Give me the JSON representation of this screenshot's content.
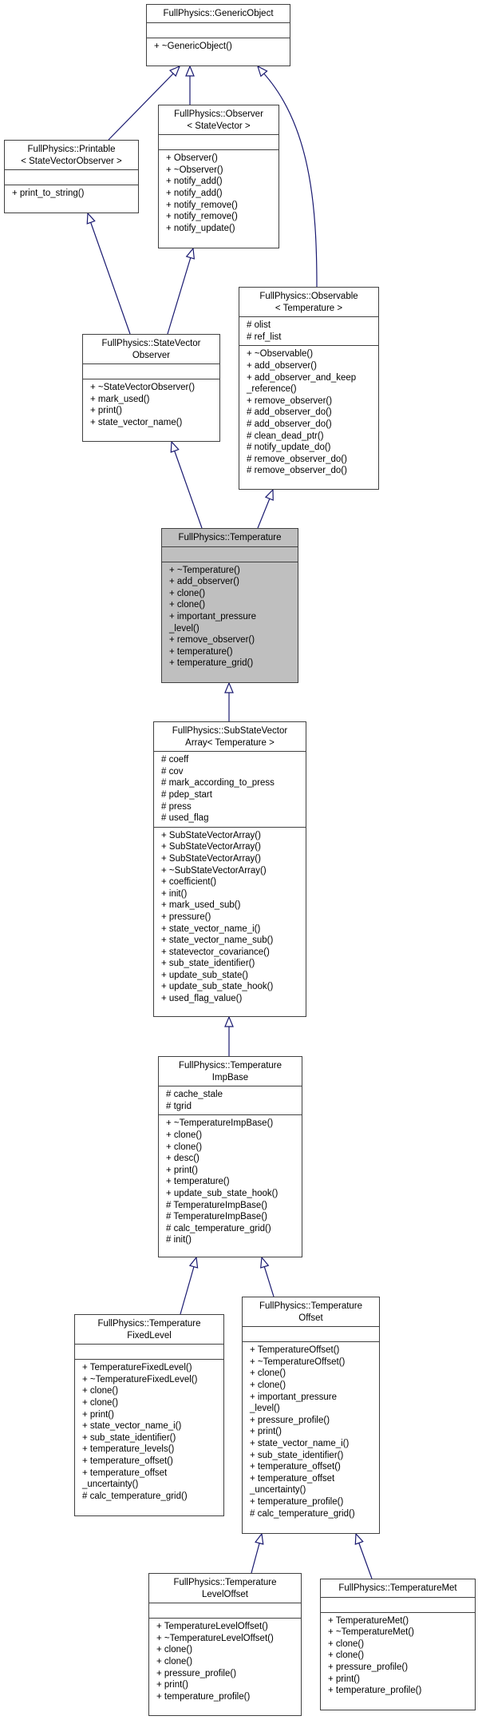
{
  "diagram": {
    "type": "class-inheritance",
    "edge_color": "#191970",
    "focus_fill": "#bfbfbf",
    "classes": {
      "generic_object": {
        "title": "FullPhysics::GenericObject",
        "attributes": [],
        "methods": [
          "+ ~GenericObject()"
        ]
      },
      "printable": {
        "title": "FullPhysics::Printable\n< StateVectorObserver >",
        "attributes": [],
        "methods": [
          "+ print_to_string()"
        ]
      },
      "observer": {
        "title": "FullPhysics::Observer\n< StateVector >",
        "attributes": [],
        "methods": [
          "+ Observer()",
          "+ ~Observer()",
          "+ notify_add()",
          "+ notify_add()",
          "+ notify_remove()",
          "+ notify_remove()",
          "+ notify_update()"
        ]
      },
      "state_vector_observer": {
        "title": "FullPhysics::StateVector\nObserver",
        "attributes": [],
        "methods": [
          "+ ~StateVectorObserver()",
          "+ mark_used()",
          "+ print()",
          "+ state_vector_name()"
        ]
      },
      "observable": {
        "title": "FullPhysics::Observable\n< Temperature >",
        "attributes": [
          "# olist",
          "# ref_list"
        ],
        "methods": [
          "+ ~Observable()",
          "+ add_observer()",
          "+ add_observer_and_keep",
          "_reference()",
          "+ remove_observer()",
          "# add_observer_do()",
          "# add_observer_do()",
          "# clean_dead_ptr()",
          "# notify_update_do()",
          "# remove_observer_do()",
          "# remove_observer_do()"
        ]
      },
      "temperature": {
        "title": "FullPhysics::Temperature",
        "attributes": [],
        "methods": [
          "+ ~Temperature()",
          "+ add_observer()",
          "+ clone()",
          "+ clone()",
          "+ important_pressure",
          "_level()",
          "+ remove_observer()",
          "+ temperature()",
          "+ temperature_grid()"
        ]
      },
      "sub_state_vector_array": {
        "title": "FullPhysics::SubStateVector\nArray< Temperature >",
        "attributes": [
          "# coeff",
          "# cov",
          "# mark_according_to_press",
          "# pdep_start",
          "# press",
          "# used_flag"
        ],
        "methods": [
          "+ SubStateVectorArray()",
          "+ SubStateVectorArray()",
          "+ SubStateVectorArray()",
          "+ ~SubStateVectorArray()",
          "+ coefficient()",
          "+ init()",
          "+ mark_used_sub()",
          "+ pressure()",
          "+ state_vector_name_i()",
          "+ state_vector_name_sub()",
          "+ statevector_covariance()",
          "+ sub_state_identifier()",
          "+ update_sub_state()",
          "+ update_sub_state_hook()",
          "+ used_flag_value()"
        ]
      },
      "temperature_imp_base": {
        "title": "FullPhysics::Temperature\nImpBase",
        "attributes": [
          "# cache_stale",
          "# tgrid"
        ],
        "methods": [
          "+ ~TemperatureImpBase()",
          "+ clone()",
          "+ clone()",
          "+ desc()",
          "+ print()",
          "+ temperature()",
          "+ update_sub_state_hook()",
          "# TemperatureImpBase()",
          "# TemperatureImpBase()",
          "# calc_temperature_grid()",
          "# init()"
        ]
      },
      "temperature_fixed_level": {
        "title": "FullPhysics::Temperature\nFixedLevel",
        "attributes": [],
        "methods": [
          "+ TemperatureFixedLevel()",
          "+ ~TemperatureFixedLevel()",
          "+ clone()",
          "+ clone()",
          "+ print()",
          "+ state_vector_name_i()",
          "+ sub_state_identifier()",
          "+ temperature_levels()",
          "+ temperature_offset()",
          "+ temperature_offset",
          "_uncertainty()",
          "# calc_temperature_grid()"
        ]
      },
      "temperature_offset": {
        "title": "FullPhysics::Temperature\nOffset",
        "attributes": [],
        "methods": [
          "+ TemperatureOffset()",
          "+ ~TemperatureOffset()",
          "+ clone()",
          "+ clone()",
          "+ important_pressure",
          "_level()",
          "+ pressure_profile()",
          "+ print()",
          "+ state_vector_name_i()",
          "+ sub_state_identifier()",
          "+ temperature_offset()",
          "+ temperature_offset",
          "_uncertainty()",
          "+ temperature_profile()",
          "# calc_temperature_grid()"
        ]
      },
      "temperature_level_offset": {
        "title": "FullPhysics::Temperature\nLevelOffset",
        "attributes": [],
        "methods": [
          "+ TemperatureLevelOffset()",
          "+ ~TemperatureLevelOffset()",
          "+ clone()",
          "+ clone()",
          "+ pressure_profile()",
          "+ print()",
          "+ temperature_profile()"
        ]
      },
      "temperature_met": {
        "title": "FullPhysics::TemperatureMet",
        "attributes": [],
        "methods": [
          "+ TemperatureMet()",
          "+ ~TemperatureMet()",
          "+ clone()",
          "+ clone()",
          "+ pressure_profile()",
          "+ print()",
          "+ temperature_profile()"
        ]
      }
    },
    "inheritance": [
      {
        "child": "printable",
        "parent": "generic_object"
      },
      {
        "child": "observer",
        "parent": "generic_object"
      },
      {
        "child": "observable",
        "parent": "generic_object"
      },
      {
        "child": "state_vector_observer",
        "parent": "printable"
      },
      {
        "child": "state_vector_observer",
        "parent": "observer"
      },
      {
        "child": "temperature",
        "parent": "state_vector_observer"
      },
      {
        "child": "temperature",
        "parent": "observable"
      },
      {
        "child": "sub_state_vector_array",
        "parent": "temperature"
      },
      {
        "child": "temperature_imp_base",
        "parent": "sub_state_vector_array"
      },
      {
        "child": "temperature_fixed_level",
        "parent": "temperature_imp_base"
      },
      {
        "child": "temperature_offset",
        "parent": "temperature_imp_base"
      },
      {
        "child": "temperature_level_offset",
        "parent": "temperature_offset"
      },
      {
        "child": "temperature_met",
        "parent": "temperature_offset"
      }
    ]
  }
}
